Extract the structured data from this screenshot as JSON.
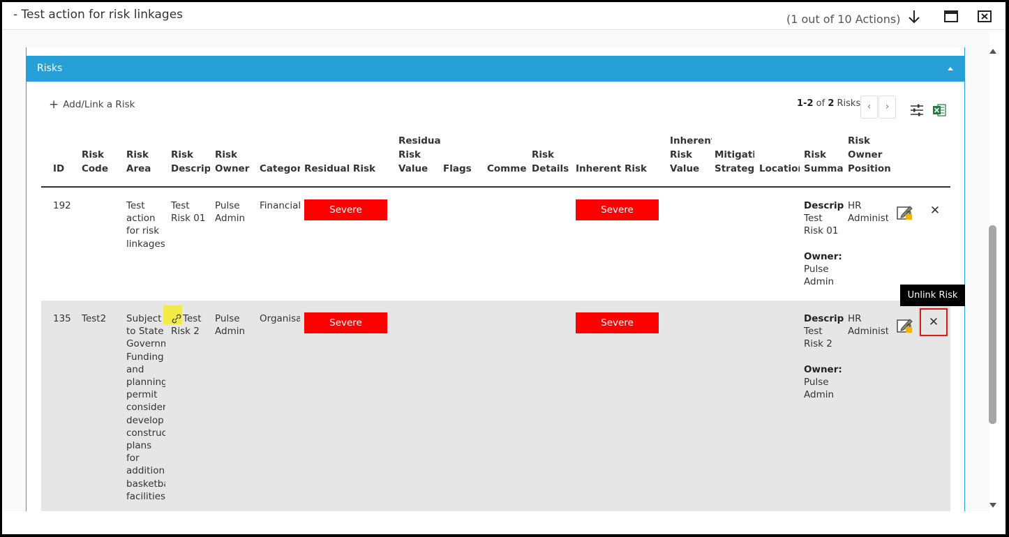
{
  "window": {
    "title": "- Test action for risk linkages",
    "counter": "(1 out of 10 Actions)"
  },
  "panel": {
    "title": "Risks",
    "add_link_label": "Add/Link a Risk",
    "pager": {
      "range": "1-2",
      "of": "of",
      "total": "2",
      "unit": "Risks"
    }
  },
  "table": {
    "headers": {
      "id": [
        "ID"
      ],
      "risk_code": [
        "Risk",
        "Code"
      ],
      "risk_area": [
        "Risk",
        "Area"
      ],
      "risk_description": [
        "Risk",
        "Descript"
      ],
      "risk_owner": [
        "Risk",
        "Owner"
      ],
      "category": [
        "Category"
      ],
      "residual_risk": [
        "Residual Risk"
      ],
      "residual_risk_value": [
        "Residual",
        "Risk",
        "Value"
      ],
      "flags": [
        "Flags"
      ],
      "comments": [
        "Commer"
      ],
      "risk_details": [
        "Risk",
        "Details"
      ],
      "inherent_risk": [
        "Inherent Risk"
      ],
      "inherent_risk_value": [
        "Inherent",
        "Risk",
        "Value"
      ],
      "mitigation_strategy": [
        "Mitigatio",
        "Strategy"
      ],
      "location": [
        "Location"
      ],
      "risk_summary": [
        "Risk",
        "Summar"
      ],
      "risk_owner_position": [
        "Risk",
        "Owner",
        "Position"
      ]
    },
    "rows": [
      {
        "id": "192",
        "risk_code": "",
        "risk_area": [
          "Test",
          "action",
          "for risk",
          "linkages"
        ],
        "risk_description": [
          "Test",
          "Risk 01"
        ],
        "risk_owner": [
          "Pulse",
          "Admin"
        ],
        "category": "Financial",
        "residual_risk": "Severe",
        "inherent_risk": "Severe",
        "summary_desc_label": "Descript",
        "summary_desc": [
          "Test",
          "Risk 01"
        ],
        "summary_owner_label": "Owner:",
        "summary_owner": [
          "Pulse",
          "Admin"
        ],
        "owner_position": [
          "HR",
          "Administ"
        ]
      },
      {
        "id": "135",
        "risk_code": "Test2",
        "risk_area": [
          "Subject",
          "to State",
          "Governm",
          "Funding",
          "and",
          "planning",
          "permit",
          "considera",
          "develop",
          "construct",
          "plans",
          "for",
          "additiona",
          "basketba",
          "facilities"
        ],
        "risk_description": [
          "Test",
          "Risk 2"
        ],
        "risk_owner": [
          "Pulse",
          "Admin"
        ],
        "category": "Organisa",
        "residual_risk": "Severe",
        "inherent_risk": "Severe",
        "summary_desc_label": "Descript",
        "summary_desc": [
          "Test",
          "Risk 2"
        ],
        "summary_owner_label": "Owner:",
        "summary_owner": [
          "Pulse",
          "Admin"
        ],
        "owner_position": [
          "HR",
          "Administ"
        ]
      }
    ]
  },
  "tooltip": "Unlink Risk",
  "colors": {
    "panel_header": "#27a0d8",
    "severe": "#ff0000",
    "highlight_border": "#d21e1e",
    "row_alt": "#e6e6e6"
  },
  "icons": [
    "arrow-down-icon",
    "maximize-icon",
    "close-icon",
    "plus-icon",
    "chevron-left-icon",
    "chevron-right-icon",
    "column-settings-icon",
    "excel-export-icon",
    "edit-lock-icon",
    "unlink-x-icon",
    "link-icon"
  ]
}
